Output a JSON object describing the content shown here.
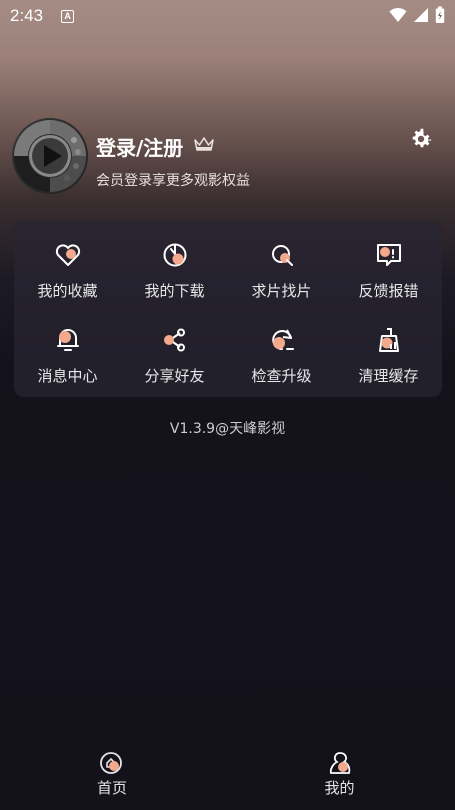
{
  "status_bar": {
    "time": "2:43",
    "notification_badge": "A"
  },
  "profile": {
    "title": "登录/注册",
    "subtitle": "会员登录享更多观影权益"
  },
  "menu": [
    {
      "label": "我的收藏",
      "icon": "heart-icon"
    },
    {
      "label": "我的下载",
      "icon": "download-icon"
    },
    {
      "label": "求片找片",
      "icon": "search-film-icon"
    },
    {
      "label": "反馈报错",
      "icon": "feedback-icon"
    },
    {
      "label": "消息中心",
      "icon": "bell-icon"
    },
    {
      "label": "分享好友",
      "icon": "share-icon"
    },
    {
      "label": "检查升级",
      "icon": "update-icon"
    },
    {
      "label": "清理缓存",
      "icon": "broom-icon"
    }
  ],
  "version": "V1.3.9@天峰影视",
  "bottom_nav": [
    {
      "label": "首页",
      "icon": "home-icon"
    },
    {
      "label": "我的",
      "icon": "profile-icon"
    }
  ],
  "colors": {
    "accent": "#f4a98c",
    "icon_outline": "#ffffff"
  }
}
